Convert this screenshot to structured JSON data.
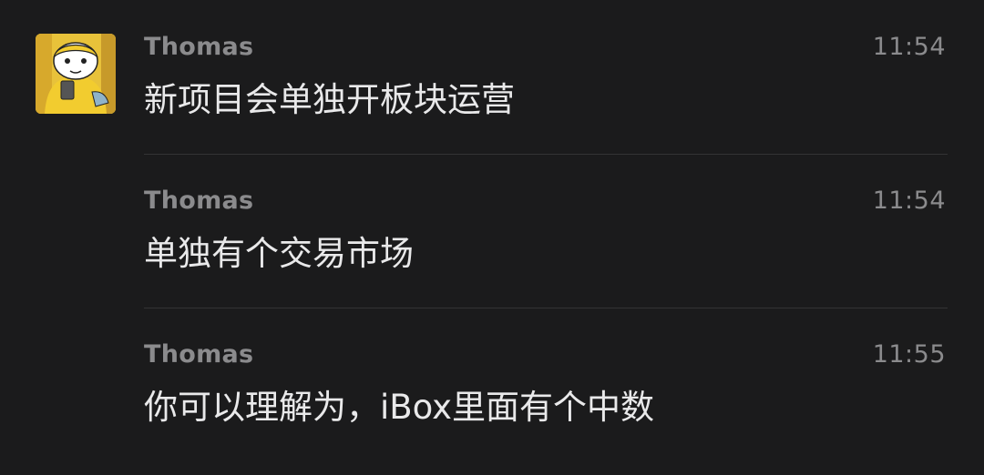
{
  "chat": {
    "messages": [
      {
        "sender": "Thomas",
        "time": "11:54",
        "text": "新项目会单独开板块运营"
      },
      {
        "sender": "Thomas",
        "time": "11:54",
        "text": "单独有个交易市场"
      },
      {
        "sender": "Thomas",
        "time": "11:55",
        "text": "你可以理解为，iBox里面有个中数"
      }
    ]
  },
  "colors": {
    "background": "#1b1b1c",
    "meta_text": "#8b8b8d",
    "message_text": "#e9e9ea",
    "divider": "#333335",
    "avatar_bg": "#e8c23a"
  },
  "icons": {
    "avatar": "cartoon-character-avatar"
  }
}
